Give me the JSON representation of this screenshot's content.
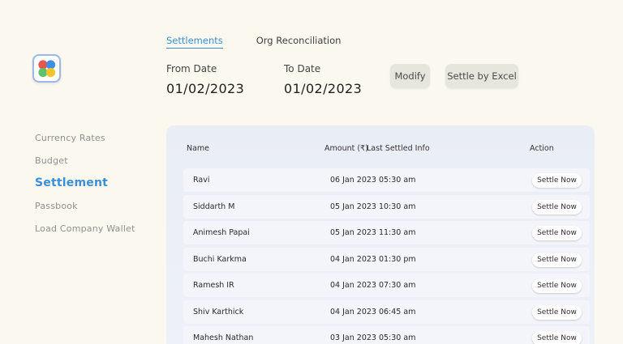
{
  "logo": {
    "icon": "four-petal-logo-icon"
  },
  "sidebar": {
    "items": [
      {
        "label": "Currency Rates"
      },
      {
        "label": "Budget"
      },
      {
        "label": "Settlement"
      },
      {
        "label": "Passbook"
      },
      {
        "label": "Load Company Wallet"
      }
    ],
    "active_index": 2
  },
  "tabs": [
    {
      "label": "Settlements"
    },
    {
      "label": "Org Reconciliation"
    }
  ],
  "filters": {
    "from_label": "From Date",
    "from_value": "01/02/2023",
    "to_label": "To Date",
    "to_value": "01/02/2023"
  },
  "buttons": {
    "modify": "Modify",
    "settle_excel": "Settle by Excel"
  },
  "table": {
    "headers": {
      "name": "Name",
      "amount": "Amount (₹)",
      "last_settled": "Last Settled Info",
      "action": "Action"
    },
    "rows": [
      {
        "name": "Ravi",
        "info": "06 Jan 2023 05:30 am",
        "action": "Settle Now"
      },
      {
        "name": "Siddarth M",
        "info": "05 Jan 2023 10:30 am",
        "action": "Settle Now"
      },
      {
        "name": "Animesh Papai",
        "info": "05 Jan 2023 11:30 am",
        "action": "Settle Now"
      },
      {
        "name": "Buchi Karkma",
        "info": "04 Jan 2023 01:30 pm",
        "action": "Settle Now"
      },
      {
        "name": "Ramesh IR",
        "info": "04 Jan 2023 07:30 am",
        "action": "Settle Now"
      },
      {
        "name": "Shiv Karthick",
        "info": "04 Jan 2023 06:45 am",
        "action": "Settle Now"
      },
      {
        "name": "Mahesh Nathan",
        "info": "03 Jan 2023 05:30 am",
        "action": "Settle Now"
      }
    ]
  },
  "colors": {
    "accent": "#3a8fd6",
    "background": "#fbf9ef",
    "panel": "#eaedf6",
    "logo_red": "#e8534b",
    "logo_blue": "#3f8ee6",
    "logo_green": "#5cc36b",
    "logo_yellow": "#f4c331"
  }
}
